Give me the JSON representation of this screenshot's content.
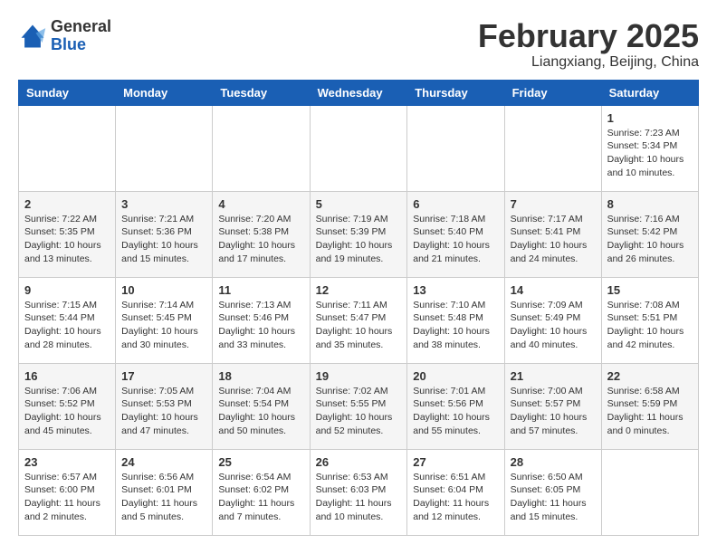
{
  "logo": {
    "general": "General",
    "blue": "Blue"
  },
  "title": {
    "month": "February 2025",
    "location": "Liangxiang, Beijing, China"
  },
  "weekdays": [
    "Sunday",
    "Monday",
    "Tuesday",
    "Wednesday",
    "Thursday",
    "Friday",
    "Saturday"
  ],
  "weeks": [
    [
      {
        "day": "",
        "info": ""
      },
      {
        "day": "",
        "info": ""
      },
      {
        "day": "",
        "info": ""
      },
      {
        "day": "",
        "info": ""
      },
      {
        "day": "",
        "info": ""
      },
      {
        "day": "",
        "info": ""
      },
      {
        "day": "1",
        "info": "Sunrise: 7:23 AM\nSunset: 5:34 PM\nDaylight: 10 hours and 10 minutes."
      }
    ],
    [
      {
        "day": "2",
        "info": "Sunrise: 7:22 AM\nSunset: 5:35 PM\nDaylight: 10 hours and 13 minutes."
      },
      {
        "day": "3",
        "info": "Sunrise: 7:21 AM\nSunset: 5:36 PM\nDaylight: 10 hours and 15 minutes."
      },
      {
        "day": "4",
        "info": "Sunrise: 7:20 AM\nSunset: 5:38 PM\nDaylight: 10 hours and 17 minutes."
      },
      {
        "day": "5",
        "info": "Sunrise: 7:19 AM\nSunset: 5:39 PM\nDaylight: 10 hours and 19 minutes."
      },
      {
        "day": "6",
        "info": "Sunrise: 7:18 AM\nSunset: 5:40 PM\nDaylight: 10 hours and 21 minutes."
      },
      {
        "day": "7",
        "info": "Sunrise: 7:17 AM\nSunset: 5:41 PM\nDaylight: 10 hours and 24 minutes."
      },
      {
        "day": "8",
        "info": "Sunrise: 7:16 AM\nSunset: 5:42 PM\nDaylight: 10 hours and 26 minutes."
      }
    ],
    [
      {
        "day": "9",
        "info": "Sunrise: 7:15 AM\nSunset: 5:44 PM\nDaylight: 10 hours and 28 minutes."
      },
      {
        "day": "10",
        "info": "Sunrise: 7:14 AM\nSunset: 5:45 PM\nDaylight: 10 hours and 30 minutes."
      },
      {
        "day": "11",
        "info": "Sunrise: 7:13 AM\nSunset: 5:46 PM\nDaylight: 10 hours and 33 minutes."
      },
      {
        "day": "12",
        "info": "Sunrise: 7:11 AM\nSunset: 5:47 PM\nDaylight: 10 hours and 35 minutes."
      },
      {
        "day": "13",
        "info": "Sunrise: 7:10 AM\nSunset: 5:48 PM\nDaylight: 10 hours and 38 minutes."
      },
      {
        "day": "14",
        "info": "Sunrise: 7:09 AM\nSunset: 5:49 PM\nDaylight: 10 hours and 40 minutes."
      },
      {
        "day": "15",
        "info": "Sunrise: 7:08 AM\nSunset: 5:51 PM\nDaylight: 10 hours and 42 minutes."
      }
    ],
    [
      {
        "day": "16",
        "info": "Sunrise: 7:06 AM\nSunset: 5:52 PM\nDaylight: 10 hours and 45 minutes."
      },
      {
        "day": "17",
        "info": "Sunrise: 7:05 AM\nSunset: 5:53 PM\nDaylight: 10 hours and 47 minutes."
      },
      {
        "day": "18",
        "info": "Sunrise: 7:04 AM\nSunset: 5:54 PM\nDaylight: 10 hours and 50 minutes."
      },
      {
        "day": "19",
        "info": "Sunrise: 7:02 AM\nSunset: 5:55 PM\nDaylight: 10 hours and 52 minutes."
      },
      {
        "day": "20",
        "info": "Sunrise: 7:01 AM\nSunset: 5:56 PM\nDaylight: 10 hours and 55 minutes."
      },
      {
        "day": "21",
        "info": "Sunrise: 7:00 AM\nSunset: 5:57 PM\nDaylight: 10 hours and 57 minutes."
      },
      {
        "day": "22",
        "info": "Sunrise: 6:58 AM\nSunset: 5:59 PM\nDaylight: 11 hours and 0 minutes."
      }
    ],
    [
      {
        "day": "23",
        "info": "Sunrise: 6:57 AM\nSunset: 6:00 PM\nDaylight: 11 hours and 2 minutes."
      },
      {
        "day": "24",
        "info": "Sunrise: 6:56 AM\nSunset: 6:01 PM\nDaylight: 11 hours and 5 minutes."
      },
      {
        "day": "25",
        "info": "Sunrise: 6:54 AM\nSunset: 6:02 PM\nDaylight: 11 hours and 7 minutes."
      },
      {
        "day": "26",
        "info": "Sunrise: 6:53 AM\nSunset: 6:03 PM\nDaylight: 11 hours and 10 minutes."
      },
      {
        "day": "27",
        "info": "Sunrise: 6:51 AM\nSunset: 6:04 PM\nDaylight: 11 hours and 12 minutes."
      },
      {
        "day": "28",
        "info": "Sunrise: 6:50 AM\nSunset: 6:05 PM\nDaylight: 11 hours and 15 minutes."
      },
      {
        "day": "",
        "info": ""
      }
    ]
  ]
}
